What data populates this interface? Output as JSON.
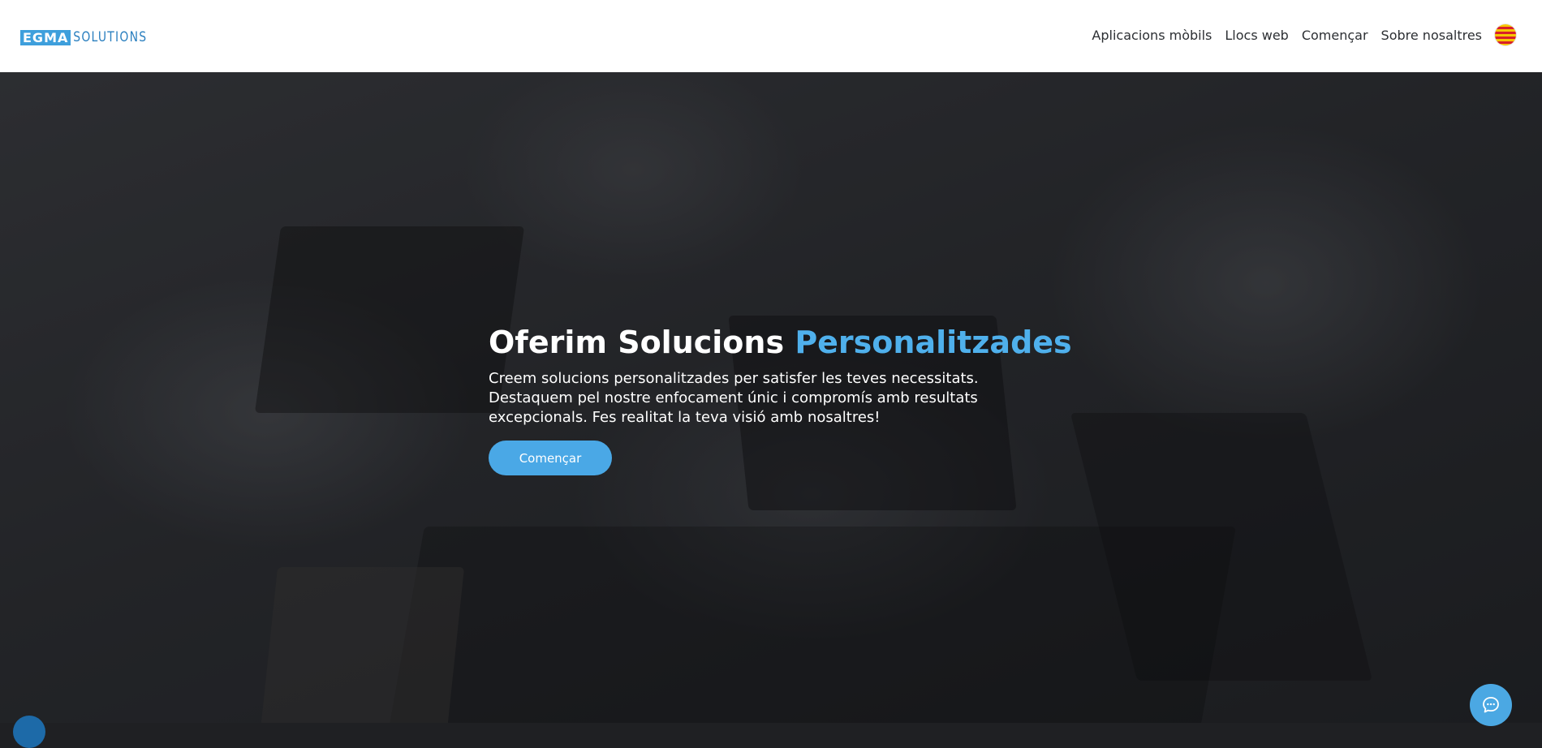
{
  "header": {
    "logo": {
      "part1": "EGMA",
      "part2": "SOLUTIONS"
    },
    "nav": [
      {
        "label": "Aplicacions mòbils"
      },
      {
        "label": "Llocs web"
      },
      {
        "label": "Començar"
      },
      {
        "label": "Sobre nosaltres"
      }
    ],
    "language_flag_icon": "catalan-flag-icon"
  },
  "hero": {
    "title_main": "Oferim Solucions ",
    "title_accent": "Personalitzades",
    "description": "Creem solucions personalitzades per satisfer les teves necessitats. Destaquem pel nostre enfocament únic i compromís amb resultats excepcionals. Fes realitat la teva visió amb nosaltres!",
    "cta_label": "Començar"
  },
  "chat_icon": "chat-bubble-icon",
  "colors": {
    "accent": "#4fb0ec",
    "button": "#4aa8e6",
    "logo_blue": "#3e9fdc",
    "header_bg": "#ffffff"
  }
}
